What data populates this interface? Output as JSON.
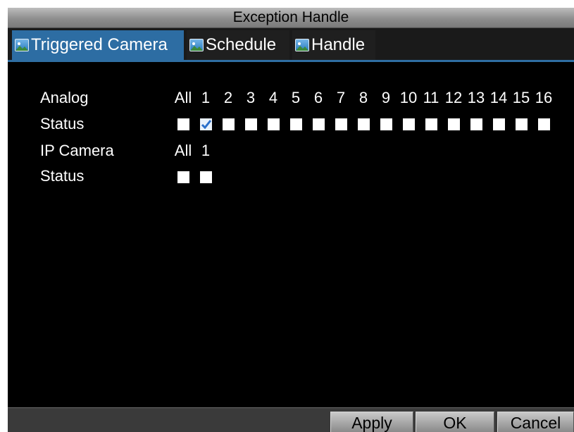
{
  "window": {
    "title": "Exception Handle"
  },
  "tabs": [
    {
      "label": "Triggered Camera",
      "icon": "camera-icon",
      "active": true
    },
    {
      "label": "Schedule",
      "icon": "camera-icon",
      "active": false
    },
    {
      "label": "Handle",
      "icon": "camera-icon",
      "active": false
    }
  ],
  "analog": {
    "row_label": "Analog",
    "status_label": "Status",
    "columns": [
      "All",
      "1",
      "2",
      "3",
      "4",
      "5",
      "6",
      "7",
      "8",
      "9",
      "10",
      "11",
      "12",
      "13",
      "14",
      "15",
      "16"
    ],
    "checked": [
      false,
      true,
      false,
      false,
      false,
      false,
      false,
      false,
      false,
      false,
      false,
      false,
      false,
      false,
      false,
      false,
      false
    ]
  },
  "ip_camera": {
    "row_label": "IP Camera",
    "status_label": "Status",
    "columns": [
      "All",
      "1"
    ],
    "checked": [
      false,
      false
    ]
  },
  "footer": {
    "apply_label": "Apply",
    "ok_label": "OK",
    "cancel_label": "Cancel"
  },
  "colors": {
    "active_tab": "#2d6da3",
    "background": "#000000",
    "check_mark": "#2a6fc9"
  }
}
